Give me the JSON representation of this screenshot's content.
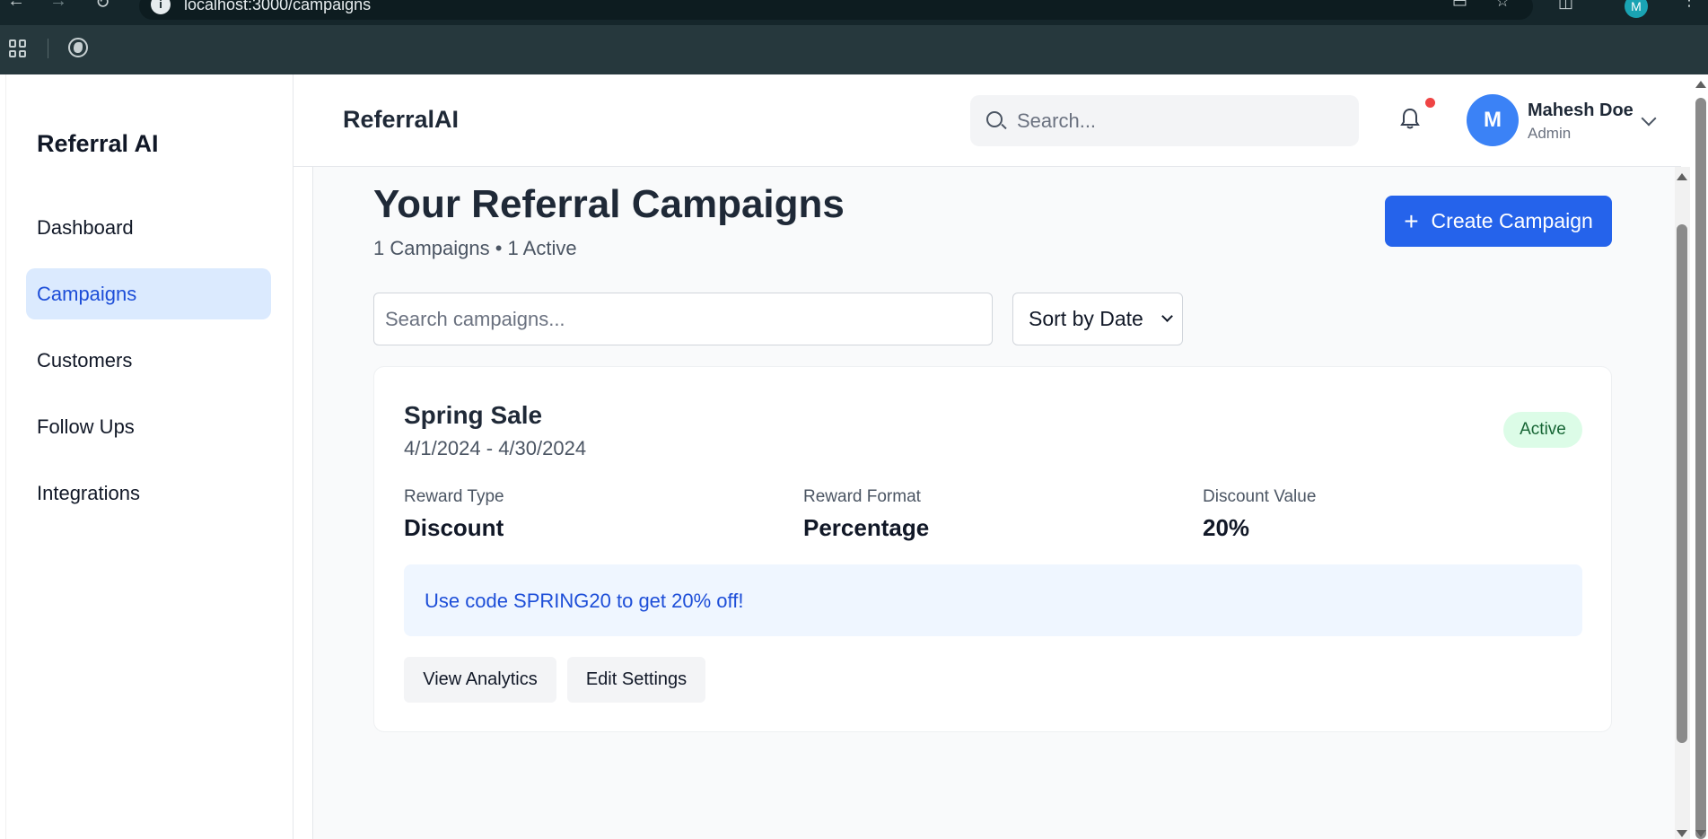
{
  "browser": {
    "url": "localhost:3000/campaigns",
    "profile_initial": "M"
  },
  "sidebar": {
    "brand": "Referral AI",
    "items": [
      {
        "label": "Dashboard"
      },
      {
        "label": "Campaigns",
        "active": true
      },
      {
        "label": "Customers"
      },
      {
        "label": "Follow Ups"
      },
      {
        "label": "Integrations"
      }
    ]
  },
  "header": {
    "title": "ReferralAI",
    "search_placeholder": "Search...",
    "user": {
      "initial": "M",
      "name": "Mahesh Doe",
      "role": "Admin"
    }
  },
  "page": {
    "title": "Your Referral Campaigns",
    "subtitle": "1 Campaigns • 1 Active",
    "create_label": "Create Campaign",
    "search_placeholder": "Search campaigns...",
    "sort_value": "Sort by Date"
  },
  "campaigns": [
    {
      "name": "Spring Sale",
      "dates": "4/1/2024 - 4/30/2024",
      "status": "Active",
      "fields": [
        {
          "label": "Reward Type",
          "value": "Discount"
        },
        {
          "label": "Reward Format",
          "value": "Percentage"
        },
        {
          "label": "Discount Value",
          "value": "20%"
        }
      ],
      "message": "Use code SPRING20 to get 20% off!",
      "actions": {
        "analytics": "View Analytics",
        "settings": "Edit Settings"
      }
    }
  ],
  "colors": {
    "primary": "#2563eb",
    "active_nav_bg": "#dbeafe",
    "status_bg": "#dcfce7",
    "notification_dot": "#ef4444"
  }
}
